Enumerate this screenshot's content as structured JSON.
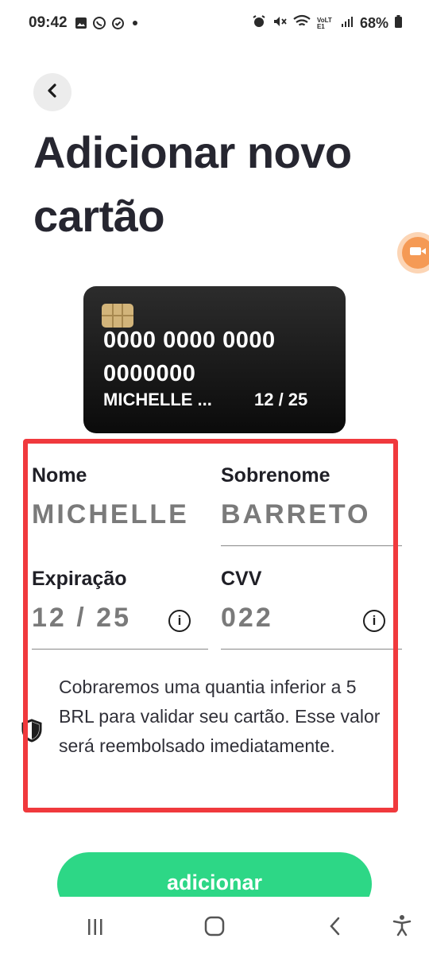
{
  "status_bar": {
    "time": "09:42",
    "left_icons": [
      "image-icon",
      "whatsapp-icon",
      "check-circle-icon",
      "dot-icon"
    ],
    "right_icons": [
      "alarm-icon",
      "mute-icon",
      "wifi-icon",
      "volte-icon",
      "signal-icon",
      "battery-icon"
    ],
    "volte_label": "VoLTE1",
    "battery": "68%"
  },
  "header": {
    "back_icon": "chevron-left-icon",
    "title": "Adicionar novo cartão"
  },
  "floating_button": {
    "icon": "video-camera-icon",
    "color": "#f59a55"
  },
  "card_preview": {
    "number_line_1": "0000 0000 0000",
    "number_line_2": "0000000",
    "holder": "MICHELLE ...",
    "expiry": "12 / 25"
  },
  "form": {
    "first_name": {
      "label": "Nome",
      "value": "MICHELLE"
    },
    "last_name": {
      "label": "Sobrenome",
      "value": "BARRETO"
    },
    "expiration": {
      "label": "Expiração",
      "value": "12 / 25",
      "info_icon": "info-icon"
    },
    "cvv": {
      "label": "CVV",
      "value": "022",
      "info_icon": "info-icon"
    }
  },
  "notice": {
    "icon": "shield-icon",
    "text": "Cobraremos uma quantia inferior a 5 BRL para validar seu cartão. Esse valor será reembolsado imediatamente."
  },
  "submit_button": {
    "label": "adicionar",
    "color": "#2dd786"
  },
  "highlight_color": "#f0393d",
  "nav_bar": {
    "icons": [
      "recent-apps-icon",
      "home-icon",
      "back-icon",
      "accessibility-icon"
    ]
  }
}
